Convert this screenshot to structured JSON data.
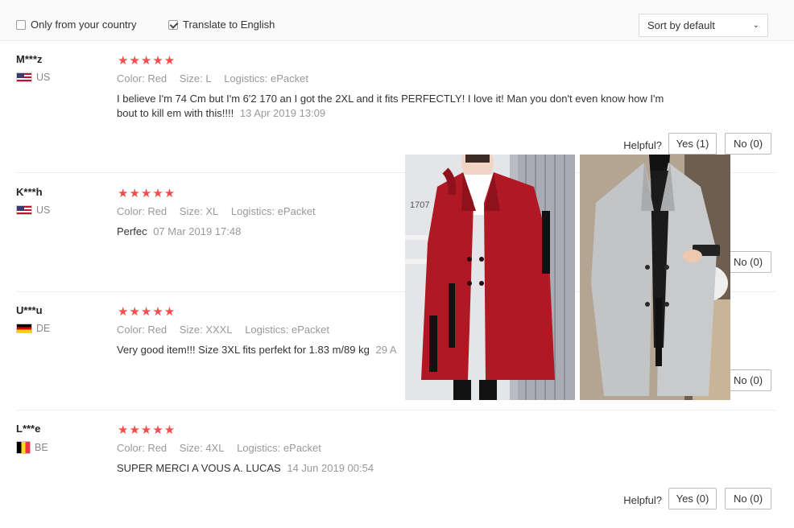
{
  "filters": {
    "only_country_label": "Only from your country",
    "only_country_checked": false,
    "translate_label": "Translate to English",
    "translate_checked": true,
    "sort_value": "Sort by default"
  },
  "reviews": [
    {
      "user": "M***z",
      "country": "US",
      "rating": "★★★★★",
      "color_label": "Color:",
      "color": "Red",
      "size_label": "Size:",
      "size": "L",
      "logistics_label": "Logistics:",
      "logistics": "ePacket",
      "text": "I believe I'm 74 Cm but I'm 6'2 170 an I got the 2XL and it fits PERFECTLY! I love it! Man you don't even know how I'm bout to kill em with this!!!!",
      "date": "13 Apr 2019 13:09",
      "helpful_label": "Helpful?",
      "yes": "Yes (1)",
      "no": "No (0)"
    },
    {
      "user": "K***h",
      "country": "US",
      "rating": "★★★★★",
      "color_label": "Color:",
      "color": "Red",
      "size_label": "Size:",
      "size": "XL",
      "logistics_label": "Logistics:",
      "logistics": "ePacket",
      "text": "Perfec",
      "date": "07 Mar 2019 17:48",
      "no": "No (0)"
    },
    {
      "user": "U***u",
      "country": "DE",
      "rating": "★★★★★",
      "color_label": "Color:",
      "color": "Red",
      "size_label": "Size:",
      "size": "XXXL",
      "logistics_label": "Logistics:",
      "logistics": "ePacket",
      "text": "Very good item!!! Size 3XL fits perfekt for 1.83 m/89 kg",
      "date": "29 A",
      "no": "No (0)"
    },
    {
      "user": "L***e",
      "country": "BE",
      "rating": "★★★★★",
      "color_label": "Color:",
      "color": "Red",
      "size_label": "Size:",
      "size": "4XL",
      "logistics_label": "Logistics:",
      "logistics": "ePacket",
      "text": "SUPER MERCI A VOUS A. LUCAS",
      "date": "14 Jun 2019 00:54",
      "helpful_label": "Helpful?",
      "yes": "Yes (0)",
      "no": "No (0)"
    }
  ],
  "photo_overlay": {
    "red_coat_text": "1707"
  }
}
